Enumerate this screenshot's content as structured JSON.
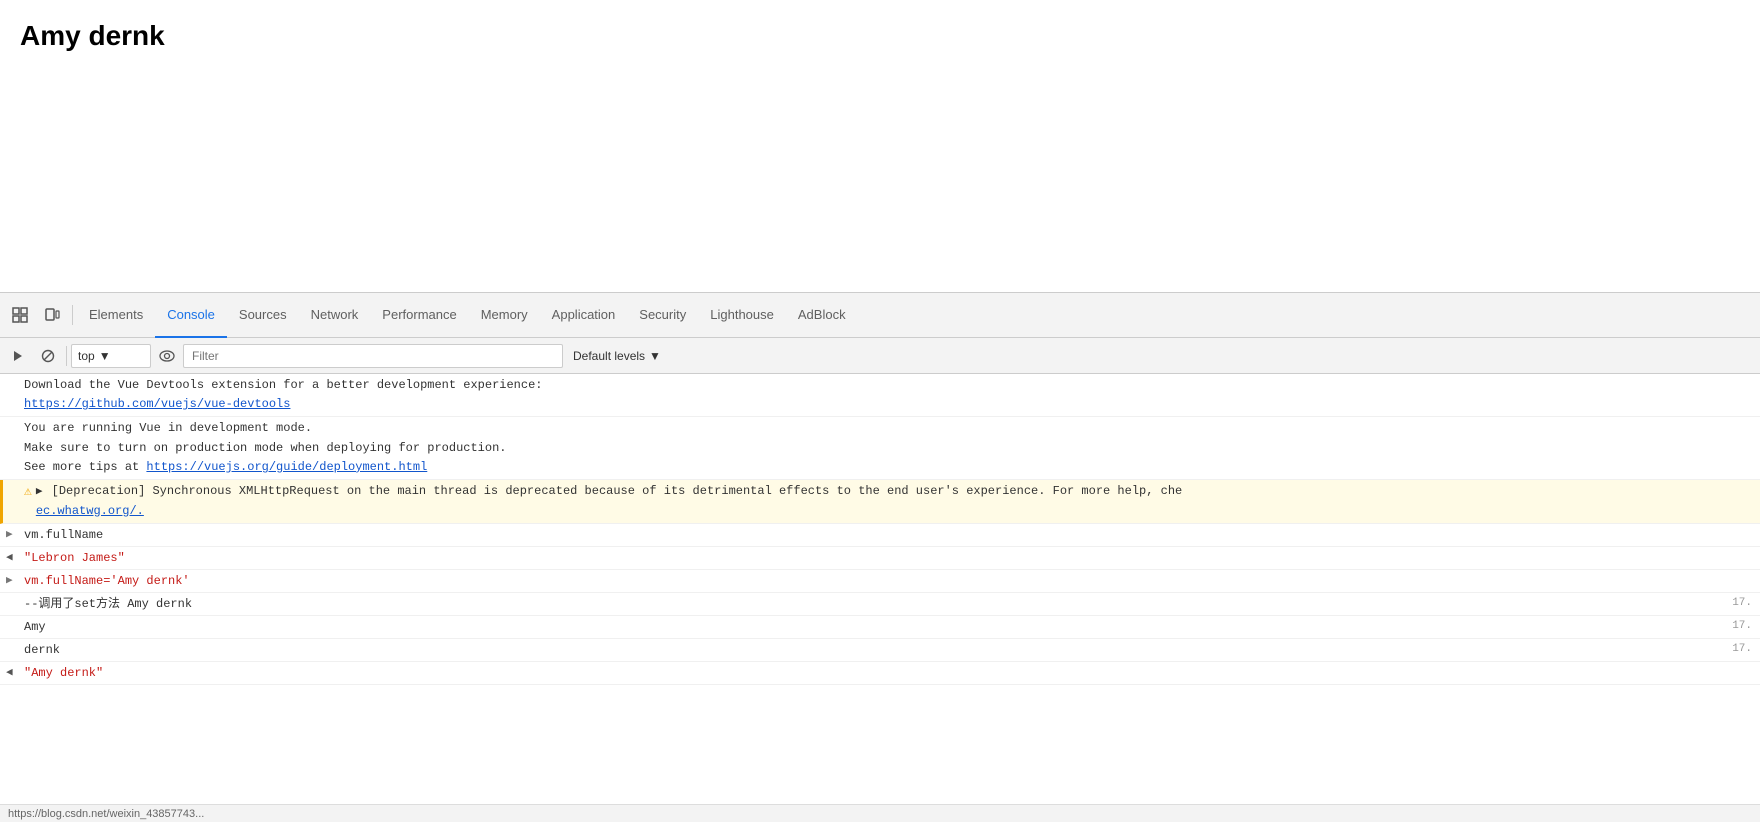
{
  "page": {
    "title": "Amy dernk"
  },
  "devtools": {
    "tabs": [
      {
        "id": "elements",
        "label": "Elements",
        "active": false
      },
      {
        "id": "console",
        "label": "Console",
        "active": true
      },
      {
        "id": "sources",
        "label": "Sources",
        "active": false
      },
      {
        "id": "network",
        "label": "Network",
        "active": false
      },
      {
        "id": "performance",
        "label": "Performance",
        "active": false
      },
      {
        "id": "memory",
        "label": "Memory",
        "active": false
      },
      {
        "id": "application",
        "label": "Application",
        "active": false
      },
      {
        "id": "security",
        "label": "Security",
        "active": false
      },
      {
        "id": "lighthouse",
        "label": "Lighthouse",
        "active": false
      },
      {
        "id": "adblock",
        "label": "AdBlock",
        "active": false
      }
    ],
    "toolbar": {
      "context": "top",
      "filter_placeholder": "Filter",
      "levels": "Default levels"
    },
    "console_lines": [
      {
        "type": "info",
        "text": "Download the Vue Devtools extension for a better development experience:\nhttps://github.com/vuejs/vue-devtools",
        "link": "https://github.com/vuejs/vue-devtools",
        "link_text": "https://github.com/vuejs/vue-devtools"
      },
      {
        "type": "info",
        "text_before": "You are running Vue in development mode.\nMake sure to turn on production mode when deploying for production.\nSee more tips at ",
        "link": "https://vuejs.org/guide/deployment.html",
        "link_text": "https://vuejs.org/guide/deployment.html"
      },
      {
        "type": "warning",
        "text": "▶[Deprecation] Synchronous XMLHttpRequest on the main thread is deprecated because of its detrimental effects to the end user's experience. For more help, che",
        "link": "ec.whatwg.org/.",
        "link_text": "ec.whatwg.org/."
      },
      {
        "type": "cmd",
        "arrow": "▶",
        "text": "vm.fullName"
      },
      {
        "type": "output",
        "arrow": "◀",
        "text": "\"Lebron James\""
      },
      {
        "type": "cmd",
        "arrow": "▶",
        "text": "vm.fullName='Amy dernk'"
      },
      {
        "type": "output-plain",
        "text": "--调用了set方法 Amy dernk",
        "linenum": "17."
      },
      {
        "type": "output-plain",
        "text": "Amy",
        "linenum": "17."
      },
      {
        "type": "output-plain",
        "text": "dernk",
        "linenum": "17."
      },
      {
        "type": "output",
        "arrow": "◀",
        "text": "\"Amy dernk\""
      }
    ],
    "status_bar": "https://blog.csdn.net/weixin_43857743..."
  }
}
